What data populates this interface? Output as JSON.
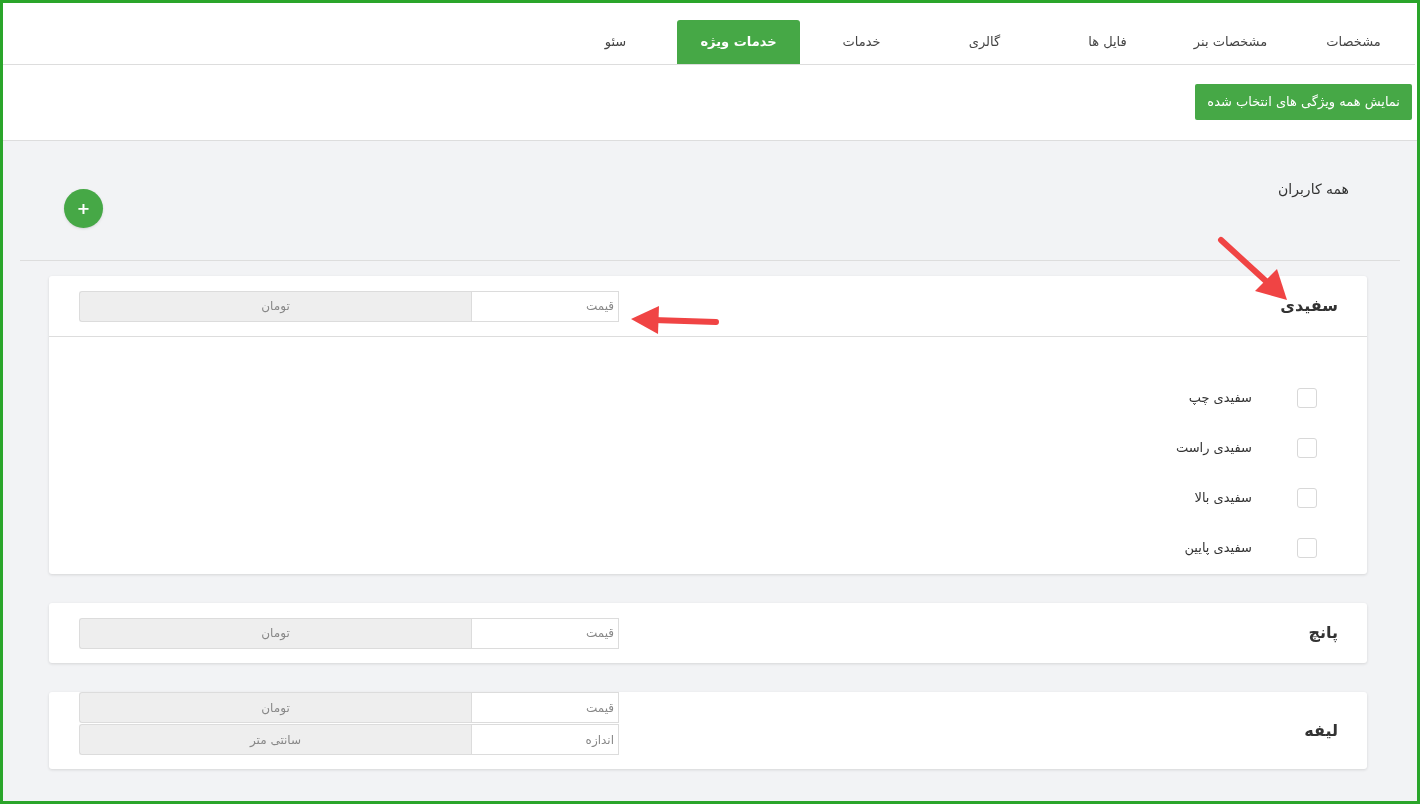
{
  "tabs": [
    {
      "label": "مشخصات",
      "selected": false
    },
    {
      "label": "مشخصات بنر",
      "selected": false
    },
    {
      "label": "فایل ها",
      "selected": false
    },
    {
      "label": "گالری",
      "selected": false
    },
    {
      "label": "خدمات",
      "selected": false
    },
    {
      "label": "خدمات ویژه",
      "selected": true
    },
    {
      "label": "سئو",
      "selected": false
    }
  ],
  "show_all_button": "نمایش همه ویژگی های انتخاب شده",
  "section_title": "همه کاربران",
  "add_button": "+",
  "groups": [
    {
      "title": "سفیدی",
      "fields": [
        {
          "placeholder": "قیمت",
          "unit": "تومان"
        }
      ],
      "options": [
        {
          "label": "سفیدی چپ",
          "checked": false
        },
        {
          "label": "سفیدی راست",
          "checked": false
        },
        {
          "label": "سفیدی بالا",
          "checked": false
        },
        {
          "label": "سفیدی پایین",
          "checked": false
        }
      ]
    },
    {
      "title": "پانچ",
      "fields": [
        {
          "placeholder": "قیمت",
          "unit": "تومان"
        }
      ]
    },
    {
      "title": "لیفه",
      "fields": [
        {
          "placeholder": "قیمت",
          "unit": "تومان"
        },
        {
          "placeholder": "اندازه",
          "unit": "سانتی متر"
        }
      ]
    }
  ]
}
